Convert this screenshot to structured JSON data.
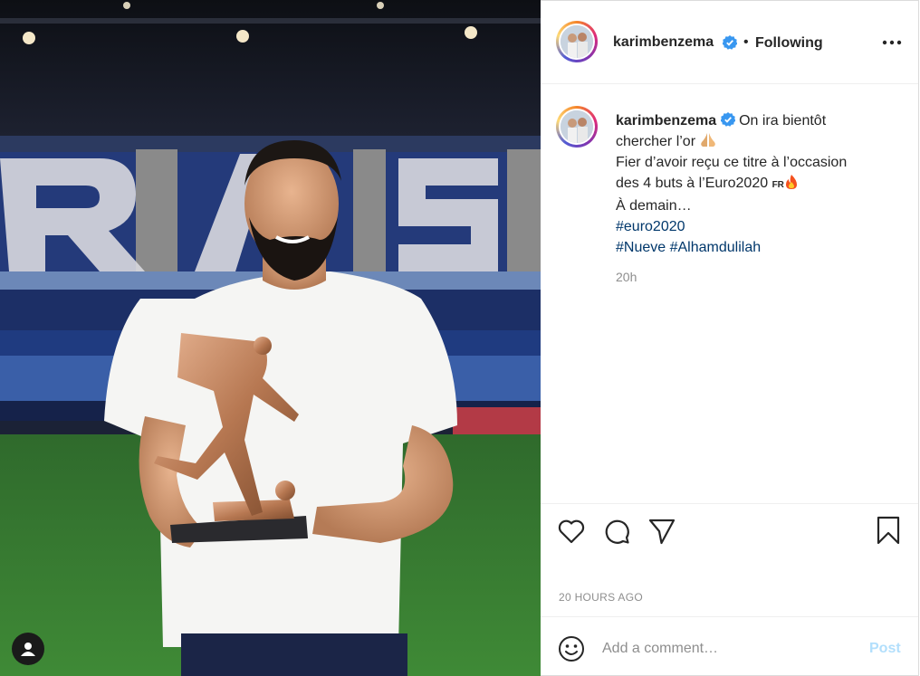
{
  "post": {
    "username": "karimbenzema",
    "following_label": "Following",
    "separator": "•",
    "caption": {
      "text_1": "On ira bientôt",
      "line_2": "chercher l’or",
      "line_3": "Fier d’avoir reçu ce titre à l’occasion",
      "line_4": "des 4 buts à l’Euro2020",
      "flag": "FR",
      "line_5": "À demain…",
      "hashtag_1": "#euro2020",
      "hashtag_2": "#Nueve",
      "hashtag_3": "#Alhamdulilah"
    },
    "caption_time": "20h",
    "posted_ago": "20 HOURS AGO"
  },
  "comment": {
    "placeholder": "Add a comment…",
    "post_label": "Post"
  },
  "icons": {
    "verified": "verified-badge-icon",
    "more": "more-options-icon",
    "like": "heart-icon",
    "comment": "comment-bubble-icon",
    "share": "paper-plane-icon",
    "save": "bookmark-icon",
    "emoji": "emoji-icon",
    "user": "user-icon",
    "praying_hands": "praying-hands-emoji",
    "fire": "fire-emoji"
  },
  "colors": {
    "verified_blue": "#3897f0",
    "hashtag": "#00376b",
    "post_disabled": "#b2dffc",
    "secondary_text": "#8e8e8e"
  }
}
